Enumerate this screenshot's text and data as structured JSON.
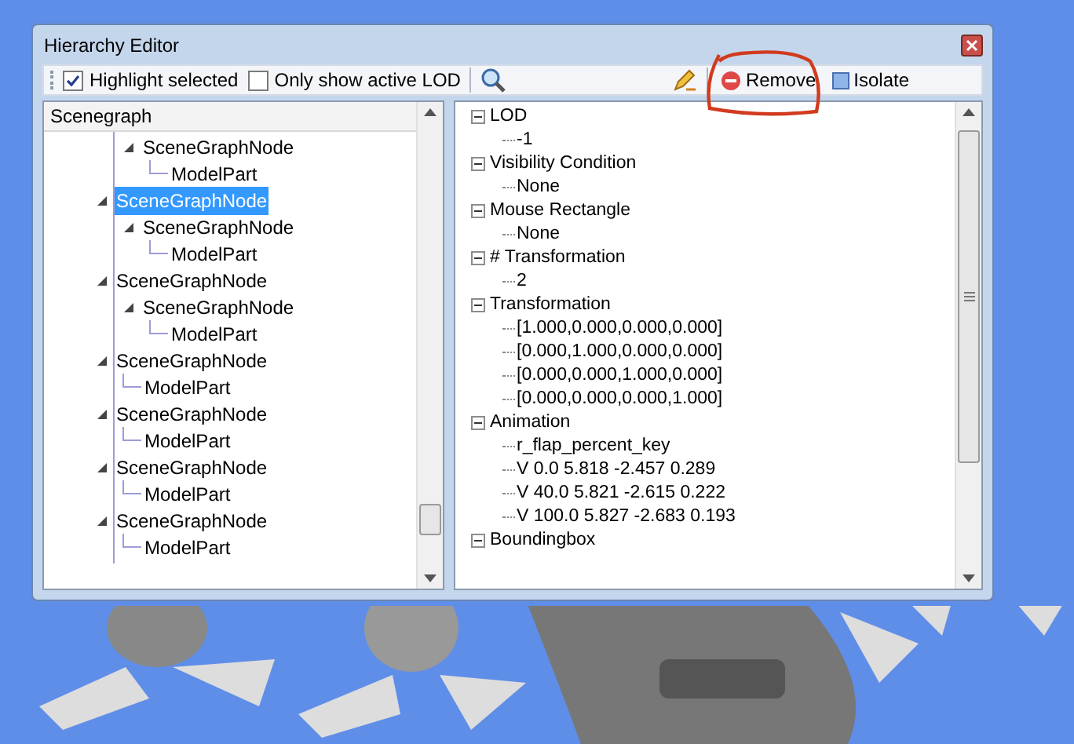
{
  "window": {
    "title": "Hierarchy Editor"
  },
  "toolbar": {
    "highlight_selected": {
      "label": "Highlight selected",
      "checked": true
    },
    "active_lod": {
      "label": "Only show active LOD",
      "checked": false
    },
    "remove": {
      "label": "Remove"
    },
    "isolate": {
      "label": "Isolate"
    }
  },
  "scenegraph": {
    "header": "Scenegraph",
    "partial_branch": [
      {
        "label": "SceneGraphNode",
        "selected": false,
        "expanded": true,
        "children": [
          {
            "label": "ModelPart",
            "selected": false
          }
        ]
      }
    ],
    "items": [
      {
        "label": "SceneGraphNode",
        "selected": true,
        "expanded": true,
        "children": [
          {
            "label": "SceneGraphNode",
            "selected": false,
            "expanded": true,
            "children": [
              {
                "label": "ModelPart",
                "selected": false
              }
            ]
          }
        ]
      },
      {
        "label": "SceneGraphNode",
        "selected": false,
        "expanded": true,
        "children": [
          {
            "label": "SceneGraphNode",
            "selected": false,
            "expanded": true,
            "children": [
              {
                "label": "ModelPart",
                "selected": false
              }
            ]
          }
        ]
      },
      {
        "label": "SceneGraphNode",
        "selected": false,
        "expanded": true,
        "children": [
          {
            "label": "ModelPart",
            "selected": false
          }
        ]
      },
      {
        "label": "SceneGraphNode",
        "selected": false,
        "expanded": true,
        "children": [
          {
            "label": "ModelPart",
            "selected": false
          }
        ]
      },
      {
        "label": "SceneGraphNode",
        "selected": false,
        "expanded": true,
        "children": [
          {
            "label": "ModelPart",
            "selected": false
          }
        ]
      },
      {
        "label": "SceneGraphNode",
        "selected": false,
        "expanded": true,
        "children": [
          {
            "label": "ModelPart",
            "selected": false
          }
        ]
      }
    ]
  },
  "properties": [
    {
      "label": "LOD",
      "expanded": true,
      "children": [
        "-1"
      ]
    },
    {
      "label": "Visibility Condition",
      "expanded": true,
      "children": [
        "None"
      ]
    },
    {
      "label": "Mouse Rectangle",
      "expanded": true,
      "children": [
        "None"
      ]
    },
    {
      "label": "# Transformation",
      "expanded": true,
      "children": [
        "2"
      ]
    },
    {
      "label": "Transformation",
      "expanded": true,
      "children": [
        "[1.000,0.000,0.000,0.000]",
        "[0.000,1.000,0.000,0.000]",
        "[0.000,0.000,1.000,0.000]",
        "[0.000,0.000,0.000,1.000]"
      ]
    },
    {
      "label": "Animation",
      "expanded": true,
      "children": [
        "r_flap_percent_key",
        "V 0.0 5.818 -2.457 0.289",
        "V 40.0 5.821 -2.615 0.222",
        "V 100.0 5.827 -2.683 0.193"
      ]
    },
    {
      "label": "Boundingbox",
      "expanded": true
    }
  ]
}
